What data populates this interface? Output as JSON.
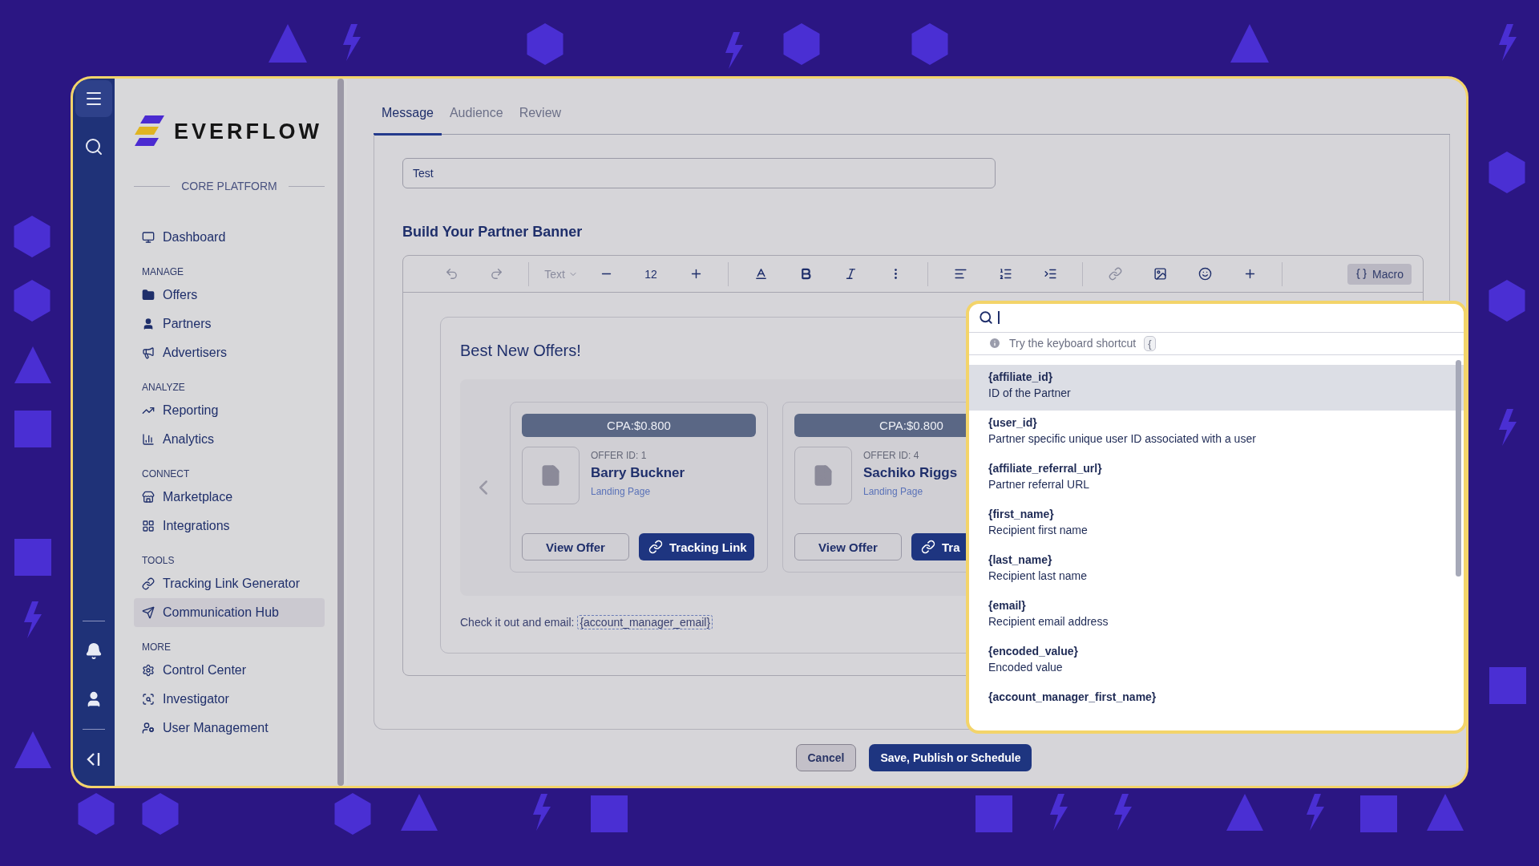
{
  "sidebar": {
    "logo": "EVERFLOW",
    "platform": "CORE PLATFORM",
    "sections": [
      {
        "items": [
          {
            "label": "Dashboard",
            "selected": false
          }
        ]
      },
      {
        "heading": "MANAGE",
        "items": [
          {
            "label": "Offers",
            "selected": false
          },
          {
            "label": "Partners",
            "selected": false
          },
          {
            "label": "Advertisers",
            "selected": false
          }
        ]
      },
      {
        "heading": "ANALYZE",
        "items": [
          {
            "label": "Reporting",
            "selected": false
          },
          {
            "label": "Analytics",
            "selected": false
          }
        ]
      },
      {
        "heading": "CONNECT",
        "items": [
          {
            "label": "Marketplace",
            "selected": false
          },
          {
            "label": "Integrations",
            "selected": false
          }
        ]
      },
      {
        "heading": "TOOLS",
        "items": [
          {
            "label": "Tracking Link Generator",
            "selected": false
          },
          {
            "label": "Communication Hub",
            "selected": true
          }
        ]
      },
      {
        "heading": "MORE",
        "items": [
          {
            "label": "Control Center",
            "selected": false
          },
          {
            "label": "Investigator",
            "selected": false
          },
          {
            "label": "User Management",
            "selected": false
          }
        ]
      }
    ]
  },
  "tabs": [
    {
      "label": "Message",
      "selected": true
    },
    {
      "label": "Audience",
      "selected": false
    },
    {
      "label": "Review",
      "selected": false
    }
  ],
  "banner_name": {
    "value": "Test"
  },
  "builder_title": "Build Your Partner Banner",
  "toolbar": [
    [
      {
        "kind": "undo",
        "disabled": true
      },
      {
        "kind": "redo",
        "disabled": true
      }
    ],
    [
      {
        "kind": "select",
        "label": "Text",
        "disabled": true
      },
      {
        "kind": "decrease",
        "disabled": false
      },
      {
        "kind": "value",
        "label": "12",
        "disabled": false
      },
      {
        "kind": "increase",
        "disabled": false
      }
    ],
    [
      {
        "kind": "font-color",
        "disabled": false
      },
      {
        "kind": "bold",
        "disabled": false
      },
      {
        "kind": "italic",
        "disabled": false
      },
      {
        "kind": "more",
        "disabled": false
      }
    ],
    [
      {
        "kind": "align",
        "disabled": false
      },
      {
        "kind": "list",
        "disabled": false
      },
      {
        "kind": "indent",
        "disabled": false
      }
    ],
    [
      {
        "kind": "link",
        "disabled": true
      },
      {
        "kind": "image",
        "disabled": false
      },
      {
        "kind": "emoji",
        "disabled": false
      },
      {
        "kind": "insert",
        "disabled": false
      }
    ]
  ],
  "macro_button": {
    "label": "Macro",
    "pressed": true
  },
  "banner": {
    "title": "Best New Offers!",
    "offers": [
      {
        "payout": "CPA:$0.800",
        "offer_id": "OFFER ID: 1",
        "name": "Barry Buckner",
        "link": "Landing Page",
        "view_button": "View Offer",
        "tracking_button": "Tracking Link"
      },
      {
        "payout": "CPA:$0.800",
        "offer_id": "OFFER ID: 4",
        "name": "Sachiko Riggs",
        "link": "Landing Page",
        "view_button": "View Offer",
        "tracking_button": "Tra"
      }
    ],
    "footer_text": "Check it out and email:",
    "footer_token": "{account_manager_email}"
  },
  "macro_menu": {
    "hint": "Try the keyboard shortcut",
    "shortcut": "{",
    "items": [
      {
        "token": "{affiliate_id}",
        "description": "ID of the Partner",
        "selected": true
      },
      {
        "token": "{user_id}",
        "description": "Partner specific unique user ID associated with a user",
        "selected": false
      },
      {
        "token": "{affiliate_referral_url}",
        "description": "Partner referral URL",
        "selected": false
      },
      {
        "token": "{first_name}",
        "description": "Recipient first name",
        "selected": false
      },
      {
        "token": "{last_name}",
        "description": "Recipient last name",
        "selected": false
      },
      {
        "token": "{email}",
        "description": "Recipient email address",
        "selected": false
      },
      {
        "token": "{encoded_value}",
        "description": "Encoded value",
        "selected": false
      },
      {
        "token": "{account_manager_first_name}",
        "selected": false
      }
    ]
  },
  "actions": [
    {
      "label": "Cancel",
      "kind": "secondary"
    },
    {
      "label": "Save, Publish or Schedule",
      "kind": "primary"
    }
  ]
}
